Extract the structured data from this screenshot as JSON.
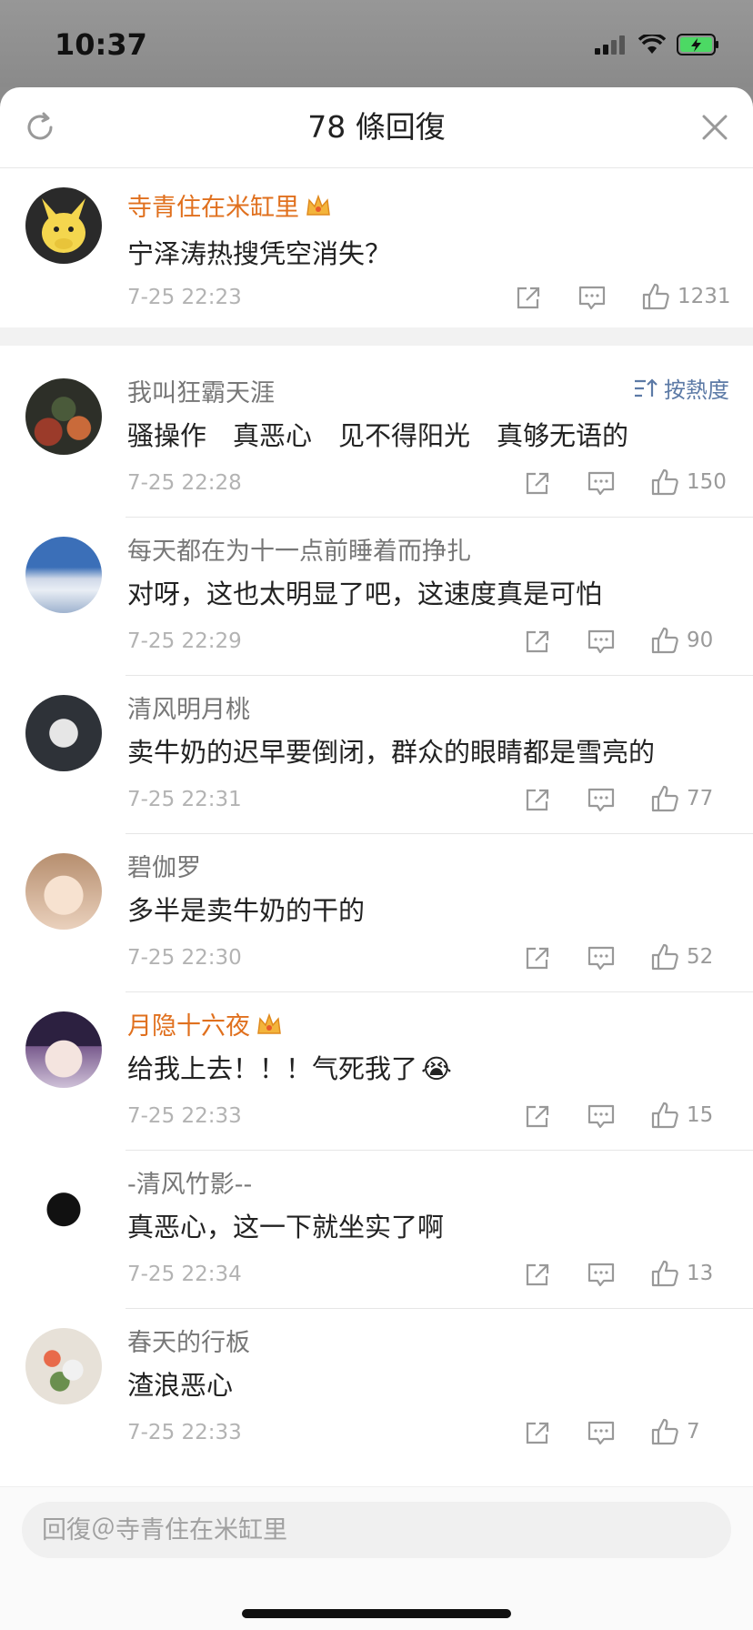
{
  "status": {
    "time": "10:37"
  },
  "header": {
    "title": "78 條回復"
  },
  "main_comment": {
    "name": "寺青住在米缸里",
    "vip": true,
    "text": "宁泽涛热搜凭空消失？",
    "time": "7-25 22:23",
    "likes": "1231"
  },
  "sort": {
    "label": "按熱度"
  },
  "replies": [
    {
      "name": "我叫狂霸天涯",
      "vip": false,
      "text": "骚操作　真恶心　见不得阳光　真够无语的",
      "time": "7-25 22:28",
      "likes": "150"
    },
    {
      "name": "每天都在为十一点前睡着而挣扎",
      "vip": false,
      "text": "对呀，这也太明显了吧，这速度真是可怕",
      "time": "7-25 22:29",
      "likes": "90"
    },
    {
      "name": "清风明月桃",
      "vip": false,
      "text": "卖牛奶的迟早要倒闭，群众的眼睛都是雪亮的",
      "time": "7-25 22:31",
      "likes": "77"
    },
    {
      "name": "碧伽罗",
      "vip": false,
      "text": "多半是卖牛奶的干的",
      "time": "7-25 22:30",
      "likes": "52"
    },
    {
      "name": "月隐十六夜",
      "vip": true,
      "text": "给我上去！！！气死我了",
      "emoji": "😭",
      "time": "7-25 22:33",
      "likes": "15"
    },
    {
      "name": "-清风竹影--",
      "vip": false,
      "text": "真恶心，这一下就坐实了啊",
      "time": "7-25 22:34",
      "likes": "13"
    },
    {
      "name": "春天的行板",
      "vip": false,
      "text": "渣浪恶心",
      "time": "7-25 22:33",
      "likes": "7"
    }
  ],
  "reply_box": {
    "placeholder": "回復＠寺青住在米缸里"
  },
  "icons": {
    "refresh": "refresh-icon",
    "close": "close-icon",
    "share": "share-icon",
    "comment": "comment-icon",
    "like": "like-icon",
    "sort": "sort-icon",
    "crown": "crown-icon"
  },
  "colors": {
    "vip_name": "#e0701e",
    "sort_blue": "#5c7aa6",
    "battery_green": "#4cd964"
  }
}
